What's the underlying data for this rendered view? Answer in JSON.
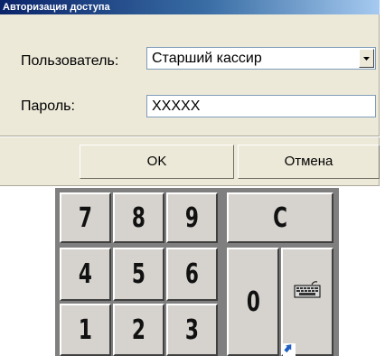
{
  "window": {
    "title": "Авторизация доступа"
  },
  "form": {
    "user_label": "Пользователь:",
    "user_value": "Старший кассир",
    "password_label": "Пароль:",
    "password_value": "XXXXX"
  },
  "buttons": {
    "ok_label": "OK",
    "cancel_label": "Отмена"
  },
  "keypad": {
    "keys": [
      "7",
      "8",
      "9",
      "C",
      "4",
      "5",
      "6",
      "0",
      "1",
      "2",
      "3"
    ],
    "keyboard_icon": "keyboard-icon"
  }
}
